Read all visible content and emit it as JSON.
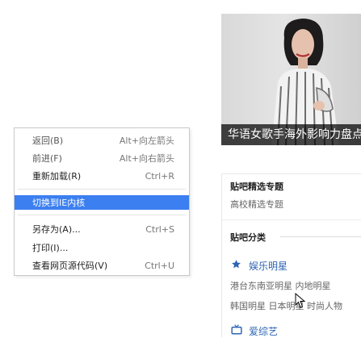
{
  "context_menu": {
    "items": [
      {
        "label": "返回(B)",
        "shortcut": "Alt+向左箭头"
      },
      {
        "label": "前进(F)",
        "shortcut": "Alt+向右箭头"
      },
      {
        "label": "重新加载(R)",
        "shortcut": "Ctrl+R"
      },
      {
        "label": "切换到IE内核",
        "shortcut": ""
      },
      {
        "label": "另存为(A)...",
        "shortcut": "Ctrl+S"
      },
      {
        "label": "打印(I)...",
        "shortcut": ""
      },
      {
        "label": "查看网页源代码(V)",
        "shortcut": "Ctrl+U"
      }
    ]
  },
  "banner": {
    "caption": "华语女歌手海外影响力盘点"
  },
  "tieba": {
    "featured_title": "贴吧精选专题",
    "featured_link": "高校精选专题",
    "category_title": "贴吧分类",
    "category_1": "娱乐明星",
    "row_1": "港台东南亚明星  内地明星",
    "row_2": "韩国明星  日本明星  时尚人物",
    "category_2": "爱综艺"
  },
  "colors": {
    "highlight": "#3b7ff0",
    "link_blue": "#2d64b3"
  }
}
